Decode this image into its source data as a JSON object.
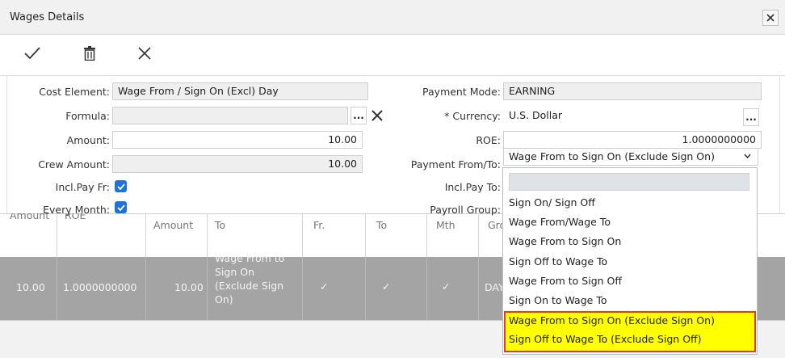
{
  "window": {
    "title": "Wages Details"
  },
  "form": {
    "cost_element": {
      "label": "Cost Element:",
      "value": "Wage From / Sign On (Excl) Day"
    },
    "formula": {
      "label": "Formula:",
      "value": ""
    },
    "amount": {
      "label": "Amount:",
      "value": "10.00"
    },
    "crew_amount": {
      "label": "Crew Amount:",
      "value": "10.00"
    },
    "incl_pay_fr": {
      "label": "Incl.Pay Fr:",
      "checked": true
    },
    "every_month": {
      "label": "Every Month:",
      "checked": true
    },
    "payment_mode": {
      "label": "Payment Mode:",
      "value": "EARNING"
    },
    "currency": {
      "label": "* Currency:",
      "value": "U.S.  Dollar"
    },
    "roe": {
      "label": "ROE:",
      "value": "1.0000000000"
    },
    "payment_from_to": {
      "label": "Payment From/To:",
      "value": "Wage From to Sign On (Exclude Sign On)"
    },
    "incl_pay_to": {
      "label": "Incl.Pay To:"
    },
    "payroll_group": {
      "label": "Payroll Group:"
    },
    "ellipsis": "...",
    "close_x": "✕"
  },
  "grid": {
    "headers": [
      "Amount",
      "ROE",
      "Amount",
      "To",
      "Fr.",
      "To",
      "Mth",
      "Gro"
    ],
    "row": {
      "amount": "10.00",
      "roe": "1.0000000000",
      "crew_amount": "10.00",
      "to": [
        "Wage From to",
        "Sign On",
        "(Exclude Sign",
        "On)"
      ],
      "fr": "✓",
      "to_chk": "✓",
      "mth": "✓",
      "group": "DAY"
    }
  },
  "dropdown": {
    "options": [
      "Sign On/ Sign Off",
      "Wage From/Wage To",
      "Wage From to Sign On",
      "Sign Off to Wage To",
      "Wage From to Sign Off",
      "Sign On to Wage To",
      "Wage From to Sign On (Exclude Sign On)",
      "Sign Off to Wage To (Exclude Sign Off)"
    ]
  },
  "colors": {
    "highlight": "#ffff00",
    "highlight_border": "#e23b2b",
    "checkbox": "#1e73d8",
    "grid_selected": "#a4a4a4"
  }
}
